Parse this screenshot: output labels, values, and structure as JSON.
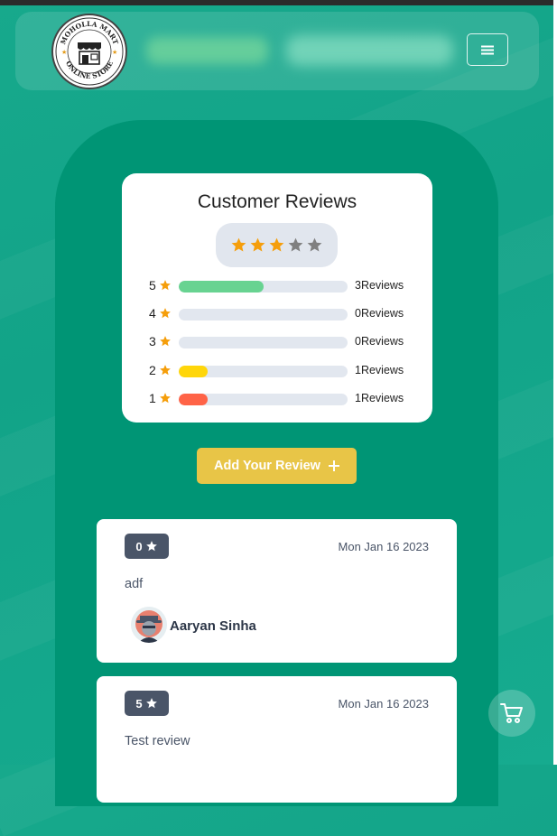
{
  "brand": {
    "logo_arc_top": "MOHOLLA MART",
    "logo_arc_bottom": "ONLINE STORE"
  },
  "icons": {
    "menu": "hamburger-icon",
    "star": "star-icon",
    "cart": "cart-icon",
    "add": "plus-icon"
  },
  "colors": {
    "background": "#12a388",
    "arch": "#009575",
    "star_filled": "#f59e0b",
    "star_empty": "#808080",
    "bar_5": "#68d391",
    "bar_2": "#ffd60a",
    "bar_1": "#ff6347",
    "button": "#e8c547",
    "badge": "#4a5568"
  },
  "summary": {
    "title": "Customer Reviews",
    "average_stars": 3,
    "max_stars": 5,
    "rows": [
      {
        "stars": "5",
        "count_label": "3Reviews",
        "fill_fraction": 0.5,
        "color": "#68d391"
      },
      {
        "stars": "4",
        "count_label": "0Reviews",
        "fill_fraction": 0,
        "color": "#68d391"
      },
      {
        "stars": "3",
        "count_label": "0Reviews",
        "fill_fraction": 0,
        "color": "#68d391"
      },
      {
        "stars": "2",
        "count_label": "1Reviews",
        "fill_fraction": 0.17,
        "color": "#ffd60a"
      },
      {
        "stars": "1",
        "count_label": "1Reviews",
        "fill_fraction": 0.17,
        "color": "#ff6347"
      }
    ]
  },
  "add_review_label": "Add Your Review",
  "reviews": [
    {
      "rating": "0",
      "date": "Mon Jan 16 2023",
      "text": "adf",
      "author": "Aaryan Sinha"
    },
    {
      "rating": "5",
      "date": "Mon Jan 16 2023",
      "text": "Test review",
      "author": ""
    }
  ]
}
